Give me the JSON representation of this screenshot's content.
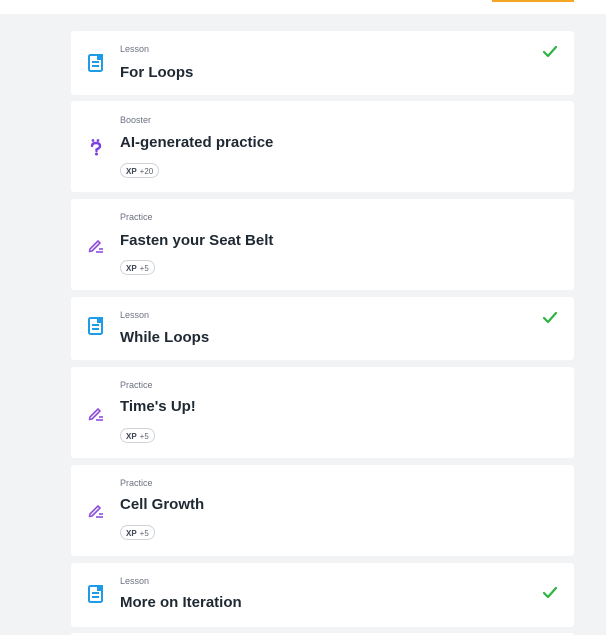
{
  "colors": {
    "lesson": "#1e9be8",
    "booster": "#7b3fe4",
    "practice": "#8e4fe0",
    "check": "#2fb344",
    "accent": "#f5a623"
  },
  "items": [
    {
      "type": "Lesson",
      "title": "For Loops",
      "icon": "lesson-document-icon",
      "completed": true
    },
    {
      "type": "Booster",
      "title": "AI-generated practice",
      "icon": "question-mark-icon",
      "xp_label": "XP",
      "xp_value": "+20"
    },
    {
      "type": "Practice",
      "title": "Fasten your Seat Belt",
      "icon": "pencil-icon",
      "xp_label": "XP",
      "xp_value": "+5"
    },
    {
      "type": "Lesson",
      "title": "While Loops",
      "icon": "lesson-document-icon",
      "completed": true
    },
    {
      "type": "Practice",
      "title": "Time's Up!",
      "icon": "pencil-icon",
      "xp_label": "XP",
      "xp_value": "+5"
    },
    {
      "type": "Practice",
      "title": "Cell Growth",
      "icon": "pencil-icon",
      "xp_label": "XP",
      "xp_value": "+5"
    },
    {
      "type": "Lesson",
      "title": "More on Iteration",
      "icon": "lesson-document-icon",
      "completed": true
    }
  ]
}
